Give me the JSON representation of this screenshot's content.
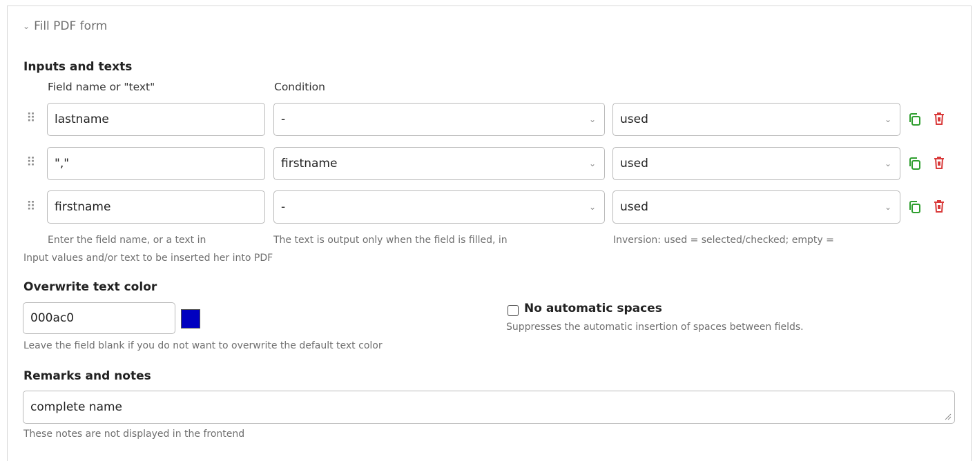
{
  "section": {
    "title": "Fill PDF form"
  },
  "inputs": {
    "heading": "Inputs and texts",
    "col_field": "Field name or \"text\"",
    "col_condition": "Condition",
    "rows": [
      {
        "field": "lastname",
        "condition": "-",
        "inversion": "used"
      },
      {
        "field": "\",\"",
        "condition": "firstname",
        "inversion": "used"
      },
      {
        "field": "firstname",
        "condition": "-",
        "inversion": "used"
      }
    ],
    "help_field": "Enter the field name, or a text in",
    "help_condition": "The text is output only when the field is filled, in",
    "help_inversion": "Inversion: used = selected/checked; empty =",
    "help_main": "Input values and/or text to be inserted her into PDF"
  },
  "color": {
    "heading": "Overwrite text color",
    "value": "000ac0",
    "swatch": "#0000c0",
    "help": "Leave the field blank if you do not want to overwrite the default text color"
  },
  "spaces": {
    "label": "No automatic spaces",
    "checked": false,
    "help": "Suppresses the automatic insertion of spaces between fields."
  },
  "remarks": {
    "heading": "Remarks and notes",
    "value": "complete name",
    "help": "These notes are not displayed in the frontend"
  },
  "icons": {
    "copy": "copy-icon",
    "delete": "trash-icon",
    "drag": "drag-handle-icon",
    "chevron": "chevron-down-icon"
  },
  "colors": {
    "copy": "#2e9e2e",
    "delete": "#d93a3a"
  }
}
